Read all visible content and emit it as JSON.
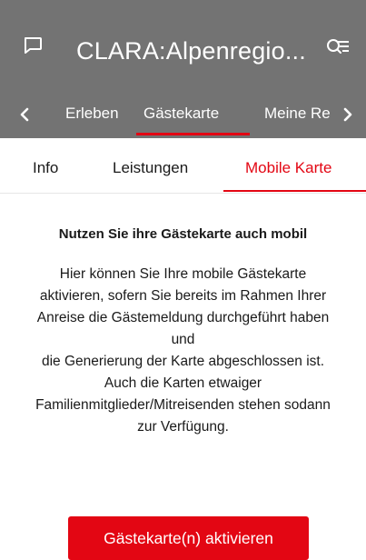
{
  "appbar": {
    "title": "CLARA:Alpenregio...",
    "left_icon": "chat-bubble-icon",
    "right_icon": "search-menu-icon"
  },
  "nav": {
    "prev_icon": "chevron-left-icon",
    "next_icon": "chevron-right-icon",
    "tabs": [
      {
        "label": "Erleben",
        "active": false
      },
      {
        "label": "Gästekarte",
        "active": true
      },
      {
        "label": "Meine Re",
        "active": false
      }
    ]
  },
  "subtabs": [
    {
      "label": "Info",
      "active": false
    },
    {
      "label": "Leistungen",
      "active": false
    },
    {
      "label": "Mobile Karte",
      "active": true
    }
  ],
  "content": {
    "heading": "Nutzen Sie ihre Gästekarte auch mobil",
    "body_lines": [
      "Hier können Sie Ihre mobile Gästekarte",
      "aktivieren, sofern Sie bereits im Rahmen Ihrer",
      "Anreise die Gästemeldung durchgeführt haben",
      "und",
      "die Generierung der Karte abgeschlossen ist.",
      "Auch die Karten etwaiger",
      "Familienmitglieder/Mitreisenden stehen sodann",
      "zur Verfügung."
    ],
    "button_label": "Gästekarte(n) aktivieren"
  },
  "colors": {
    "header_gray": "#737373",
    "accent_red": "#e30613"
  }
}
